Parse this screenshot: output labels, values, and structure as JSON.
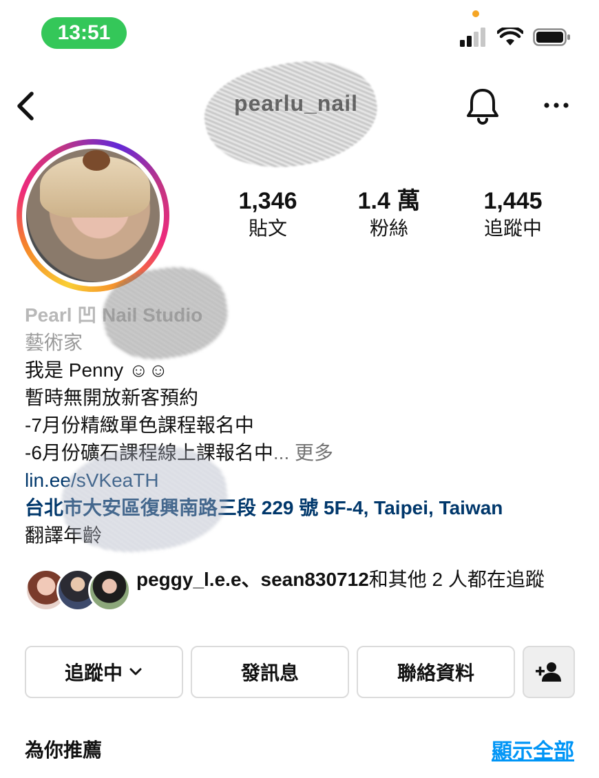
{
  "status_bar": {
    "time": "13:51"
  },
  "header": {
    "username": "pearlu_nail"
  },
  "stats": [
    {
      "value": "1,346",
      "label": "貼文"
    },
    {
      "value": "1.4 萬",
      "label": "粉絲"
    },
    {
      "value": "1,445",
      "label": "追蹤中"
    }
  ],
  "bio": {
    "name": "Pearl 凹 Nail Studio",
    "category": "藝術家",
    "lines": [
      "我是 Penny ☺☺",
      "暫時無開放新客預約",
      "-7月份精緻單色課程報名中",
      "-6月份礦石課程線上課報名中"
    ],
    "more_prefix": "...",
    "more": "更多",
    "link": "lin.ee/sVKeaTH",
    "address": "台北市大安區復興南路三段 229 號 5F-4, Taipei, Taiwan",
    "translate": "翻譯年齡"
  },
  "followed_by": {
    "users": "peggy_l.e.e、sean830712",
    "suffix": "和其他 2 人都在追蹤"
  },
  "buttons": {
    "following": "追蹤中",
    "message": "發訊息",
    "contact": "聯絡資料"
  },
  "suggested": {
    "title": "為你推薦",
    "see_all": "顯示全部"
  },
  "colors": {
    "link": "#00376b",
    "accent": "#0095f6",
    "status_pill": "#34c759"
  }
}
